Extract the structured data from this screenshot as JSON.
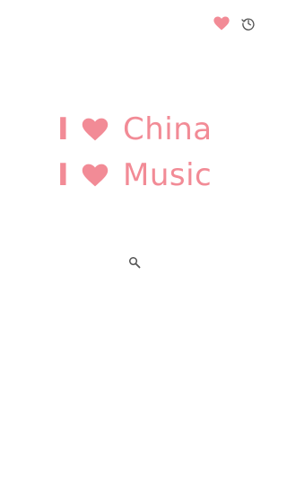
{
  "header": {
    "favorites_icon": "heart-icon",
    "history_icon": "clock-icon"
  },
  "hero": {
    "lines": [
      {
        "pronoun": "I",
        "icon": "heart-icon",
        "word": "China"
      },
      {
        "pronoun": "I",
        "icon": "heart-icon",
        "word": "Music"
      }
    ]
  },
  "search": {
    "icon": "search-icon"
  },
  "colors": {
    "accent": "#f28b96",
    "icon_gray": "#555555",
    "background": "#ffffff"
  }
}
